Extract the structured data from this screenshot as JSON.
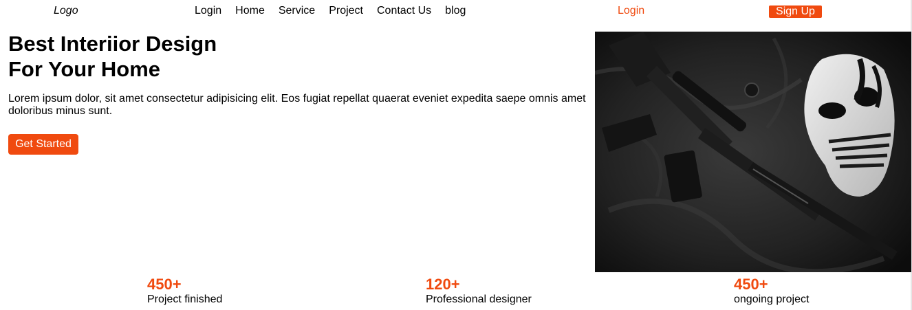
{
  "header": {
    "logo": "Logo",
    "nav": [
      "Login",
      "Home",
      "Service",
      "Project",
      "Contact Us",
      "blog"
    ],
    "login": "Login",
    "signup": "Sign Up"
  },
  "hero": {
    "title_line1": "Best Interiior Design",
    "title_line2": "For Your Home",
    "description": "Lorem ipsum dolor, sit amet consectetur adipisicing elit. Eos fugiat repellat quaerat eveniet expedita saepe omnis amet doloribus minus sunt.",
    "cta": "Get Started",
    "image": "rifle-and-mask-photo"
  },
  "stats": [
    {
      "value": "450+",
      "label": "Project finished"
    },
    {
      "value": "120+",
      "label": "Professional designer"
    },
    {
      "value": "450+",
      "label": "ongoing project"
    }
  ],
  "colors": {
    "accent": "#f04a0f",
    "text": "#000000",
    "background": "#ffffff"
  }
}
